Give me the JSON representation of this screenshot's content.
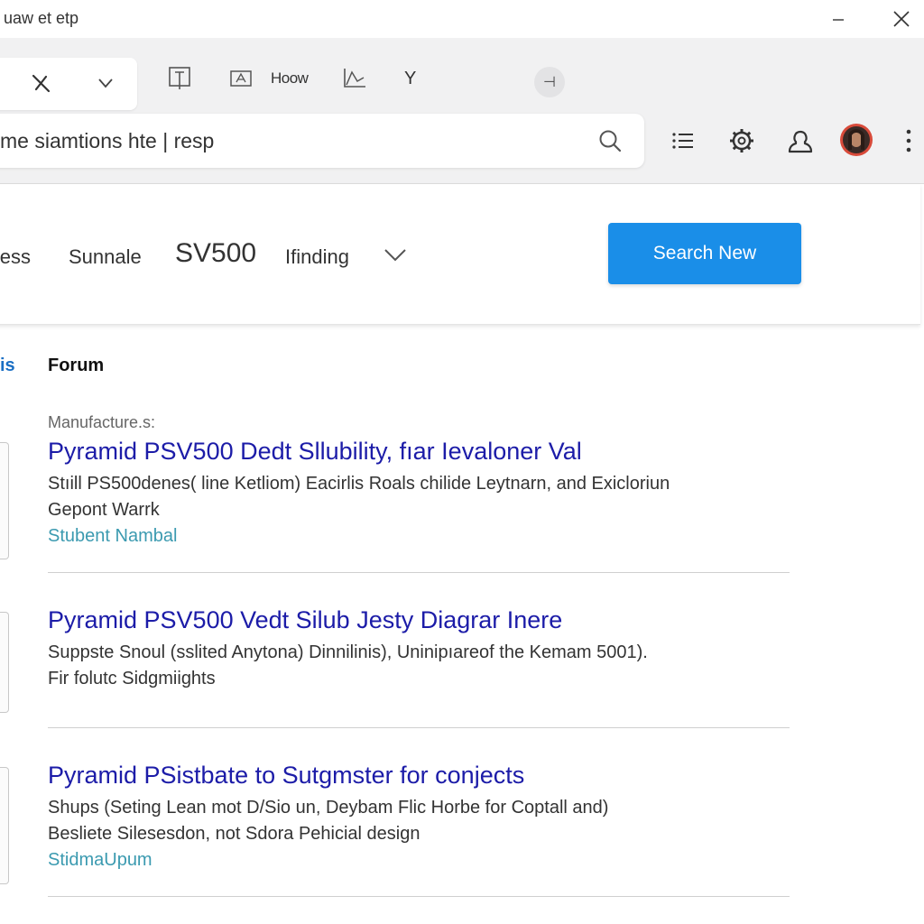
{
  "window": {
    "title": "uaw et etp",
    "minimize_label": "–",
    "close_label": "✕"
  },
  "toolbar": {
    "dropdown_icon": "close-x-icon",
    "items": [
      {
        "icon": "text-box-icon"
      },
      {
        "icon": "image-icon"
      },
      {
        "label": "Hoow"
      },
      {
        "icon": "chart-icon"
      },
      {
        "label": "Y"
      }
    ],
    "circle_button_label": "⊣"
  },
  "search": {
    "query": "me siamtions hte | resp",
    "icon": "search-icon"
  },
  "right_icons": [
    "list-icon",
    "gear-icon",
    "user-icon",
    "avatar",
    "more-vertical-icon"
  ],
  "filters": {
    "item1": "iless",
    "item2": "Sunnale",
    "item3": "SV500",
    "item4": "Ifinding",
    "search_button": "Search New"
  },
  "tabs": {
    "partial": "is",
    "forum": "Forum"
  },
  "results": [
    {
      "meta": "Manufacture.s:",
      "title": "Pyramid PSV500 Dedt Sllubility, fıar Ievaloner Val",
      "desc1": "Stıill PS500denes( line Ketliom) Eacirlis Roals chilide Leytnarn, and Exicloriun",
      "desc2": "Gepont Warrk",
      "source": "Stubent Nambal"
    },
    {
      "title": "Pyramid PSV500 Vedt Silub Jesty Diagrar Inere",
      "desc1": "Suppste Snoul (sslited Anytona) Dinnilinis), Uninipıareof the Kemam 5001).",
      "desc2": "Fir folutc Sidgmiights"
    },
    {
      "title": "Pyramid PSistbate to Sutgmster for conjects",
      "desc1": "Shups (Seting Lean mot D/Sio un, Deybam Flic Horbe for Coptall and)",
      "desc2": "Besliete Silesesdon, not Sdora Pehicial design",
      "source": "StidmaUpum"
    }
  ],
  "colors": {
    "accent": "#1a8ee8",
    "result_title": "#1c1ca8",
    "source_link": "#3b9ab0"
  }
}
